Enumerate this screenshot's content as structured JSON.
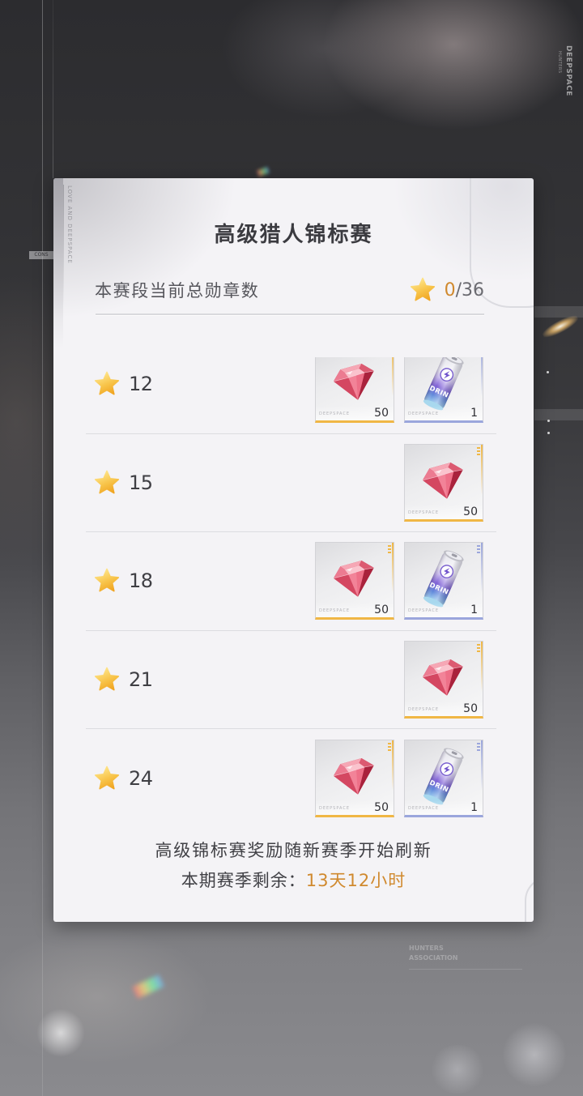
{
  "backdrop": {
    "brand_vertical": "DEEPSPACE",
    "brand_vertical_sub": "HUNTERS",
    "side_tag": "CONS",
    "association_line1": "HUNTERS",
    "association_line2": "ASSOCIATION"
  },
  "card": {
    "side_text": "LOVE AND DEEPSPACE",
    "title": "高级猎人锦标赛",
    "medal_summary": {
      "label": "本赛段当前总勋章数",
      "icon": "medal-star-icon",
      "current": "0",
      "total": "/36"
    },
    "item_brand": "DEEPSPACE",
    "can_lettering": "DRIN",
    "tiers": [
      {
        "threshold": "12",
        "rewards": [
          {
            "icon": "diamond-icon",
            "count": "50",
            "rarity_color": "#f0b745"
          },
          {
            "icon": "energy-drink-icon",
            "count": "1",
            "rarity_color": "#9ba6dc"
          }
        ]
      },
      {
        "threshold": "15",
        "rewards": [
          {
            "icon": "diamond-icon",
            "count": "50",
            "rarity_color": "#f0b745"
          }
        ]
      },
      {
        "threshold": "18",
        "rewards": [
          {
            "icon": "diamond-icon",
            "count": "50",
            "rarity_color": "#f0b745"
          },
          {
            "icon": "energy-drink-icon",
            "count": "1",
            "rarity_color": "#9ba6dc"
          }
        ]
      },
      {
        "threshold": "21",
        "rewards": [
          {
            "icon": "diamond-icon",
            "count": "50",
            "rarity_color": "#f0b745"
          }
        ]
      },
      {
        "threshold": "24",
        "rewards": [
          {
            "icon": "diamond-icon",
            "count": "50",
            "rarity_color": "#f0b745"
          },
          {
            "icon": "energy-drink-icon",
            "count": "1",
            "rarity_color": "#9ba6dc"
          }
        ]
      }
    ],
    "footer": {
      "note": "高级锦标赛奖励随新赛季开始刷新",
      "remaining_label": "本期赛季剩余：",
      "remaining_value": "13天12小时"
    }
  },
  "colors": {
    "accent_orange": "#d0892e",
    "star_gold": "#f2ac2a",
    "card_background": "#f4f3f6",
    "rarity_gold": "#f0b745",
    "rarity_blue": "#9ba6dc"
  }
}
